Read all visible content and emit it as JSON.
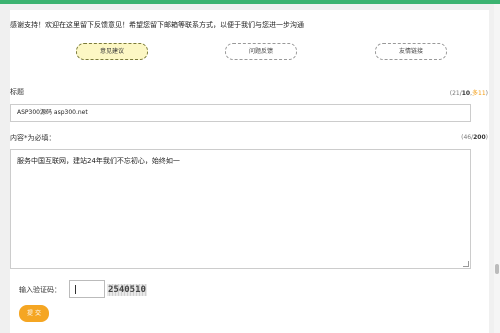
{
  "message": {
    "thanks": "感谢支持！欢迎在这里留下反馈意见！希望您留下邮箱等联系方式，以便于我们与您进一步沟通"
  },
  "types": [
    {
      "label": "意见建议",
      "active": true
    },
    {
      "label": "问题反馈",
      "active": false
    },
    {
      "label": "友情链接",
      "active": false
    }
  ],
  "title_field": {
    "label": "标题",
    "value": "ASP300源码 asp300.net",
    "counter_open": "(21/",
    "counter_max": "10",
    "counter_sep": ",",
    "counter_extra": "多11",
    "counter_close": ")"
  },
  "content_field": {
    "label": "内容*为必填：",
    "value": "服务中国互联网，建站24年我们不忘初心，始终如一",
    "counter_open": "(46/",
    "counter_max": "200",
    "counter_close": ")"
  },
  "captcha": {
    "label": "输入验证码：",
    "value": "",
    "image_text": "2540510"
  },
  "submit_label": "提 交",
  "colors": {
    "accent_green": "#3cb371",
    "submit_orange": "#f5a623",
    "active_type_bg": "#fcf7c4"
  }
}
